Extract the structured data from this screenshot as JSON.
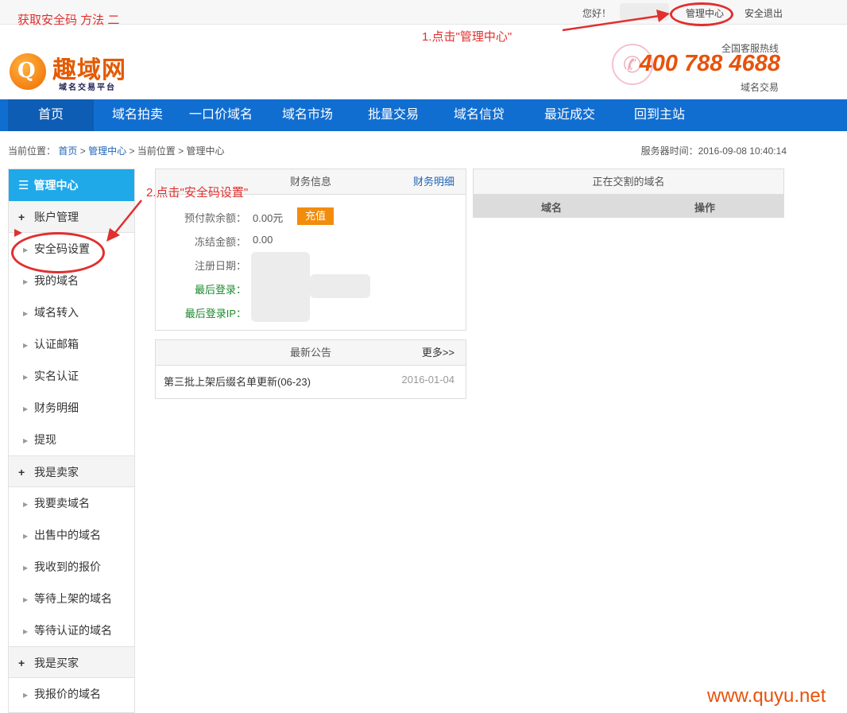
{
  "topbar": {
    "guide_title": "获取安全码 方法 二",
    "hello": "您好！",
    "management_center": "管理中心",
    "logout": "安全退出"
  },
  "brand": {
    "logo_name": "趣域网",
    "logo_sub": "域名交易平台",
    "hotline_label": "全国客服热线",
    "hotline_number": "400 788 4688",
    "hotline_sub": "域名交易"
  },
  "nav": {
    "items": [
      "首页",
      "域名拍卖",
      "一口价域名",
      "域名市场",
      "批量交易",
      "域名信贷",
      "最近成交",
      "回到主站"
    ]
  },
  "breadcrumb": {
    "prefix": "当前位置：",
    "home": "首页",
    "sep": ">",
    "mgmt": "管理中心",
    "current": "当前位置",
    "page": "管理中心",
    "server_time": "服务器时间：2016-09-08 10:40:14"
  },
  "sidebar": {
    "title": "管理中心",
    "groups": [
      {
        "label": "账户管理",
        "items": [
          "安全码设置",
          "我的域名",
          "域名转入",
          "认证邮箱",
          "实名认证",
          "财务明细",
          "提现"
        ]
      },
      {
        "label": "我是卖家",
        "items": [
          "我要卖域名",
          "出售中的域名",
          "我收到的报价",
          "等待上架的域名",
          "等待认证的域名"
        ]
      },
      {
        "label": "我是买家",
        "items": [
          "我报价的域名"
        ]
      }
    ]
  },
  "finance": {
    "title": "财务信息",
    "detail_link": "财务明细",
    "balance_label": "预付款余额：",
    "balance_value": "0.00元",
    "recharge": "充值",
    "frozen_label": "冻结金额：",
    "frozen_value": "0.00",
    "reg_label": "注册日期：",
    "last_login_label": "最后登录：",
    "last_ip_label": "最后登录IP："
  },
  "notice": {
    "title": "最新公告",
    "more": "更多>>",
    "items": [
      {
        "title": "第三批上架后缀名单更新(06-23)",
        "date": "2016-01-04"
      }
    ]
  },
  "trading": {
    "title": "正在交割的域名",
    "col_domain": "域名",
    "col_action": "操作"
  },
  "annotations": {
    "step1": "1.点击\"管理中心\"",
    "step2": "2.点击\"安全码设置\"",
    "watermark": "www.quyu.net"
  },
  "colors": {
    "nav_blue": "#116ed1",
    "sidebar_head": "#1fa9e9",
    "accent_orange": "#e8520a",
    "recharge_orange": "#f28c0c",
    "annotation_red": "#e0302f",
    "login_green": "#1b8a2c"
  },
  "icons": {
    "menu": "hamburger-icon",
    "phone": "phone-icon",
    "expand": "plus-icon",
    "item": "triangle-right-icon"
  }
}
